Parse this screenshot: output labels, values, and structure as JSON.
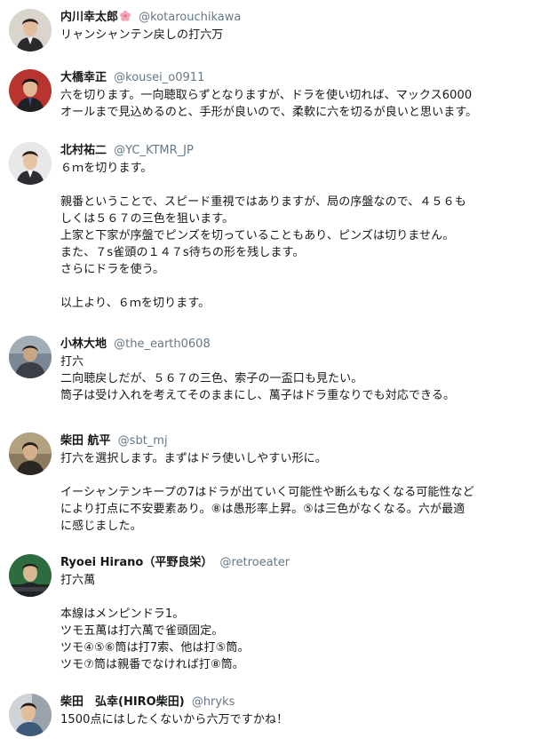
{
  "tweets": [
    {
      "name": "内川幸太郎",
      "handle": "@kotarouchikawa",
      "lines": [
        "リャンシャンテン戻しの打六万"
      ]
    },
    {
      "name": "大橋幸正",
      "handle": "@kousei_o0911",
      "lines": [
        "六を切ります。一向聴取らずとなりますが、ドラを使い切れば、マックス6000",
        "オールまで見込めるのと、手形が良いので、柔軟に六を切るが良いと思います。"
      ]
    },
    {
      "name": "北村祐二",
      "handle": "@YC_KTMR_JP",
      "lines": [
        "６ｍを切ります。",
        "",
        "親番ということで、スピード重視ではありますが、局の序盤なので、４５６も",
        "しくは５６７の三色を狙います。",
        "上家と下家が序盤でピンズを切っていることもあり、ピンズは切りません。",
        "また、７s雀頭の１４７s待ちの形を残します。",
        "さらにドラを使う。",
        "",
        "以上より、６ｍを切ります。"
      ]
    },
    {
      "name": "小林大地",
      "handle": "@the_earth0608",
      "lines": [
        "打六",
        "二向聴戻しだが、５６７の三色、索子の一盃口も見たい。",
        "筒子は受け入れを考えてそのままにし、萬子はドラ重なりでも対応できる。"
      ]
    },
    {
      "name": "柴田 航平",
      "handle": "@sbt_mj",
      "lines": [
        "打六を選択します。まずはドラ使いしやすい形に。",
        "",
        "イーシャンテンキープの7はドラが出ていく可能性や断么もなくなる可能性など",
        "により打点に不安要素あり。⑧は愚形率上昇。⑤は三色がなくなる。六が最適",
        "に感じました。"
      ]
    },
    {
      "name": "Ryoei Hirano（平野良栄）",
      "handle": "@retroeater",
      "lines": [
        "打六萬",
        "",
        "本線はメンピンドラ1。",
        "ツモ五萬は打六萬で雀頭固定。",
        "ツモ④⑤⑥筒は打7索、他は打⑤筒。",
        "ツモ⑦筒は親番でなければ打⑧筒。"
      ]
    },
    {
      "name": "柴田　弘幸(HIRO柴田)",
      "handle": "@hryks",
      "lines": [
        "1500点にはしたくないから六万ですかね！"
      ]
    }
  ]
}
